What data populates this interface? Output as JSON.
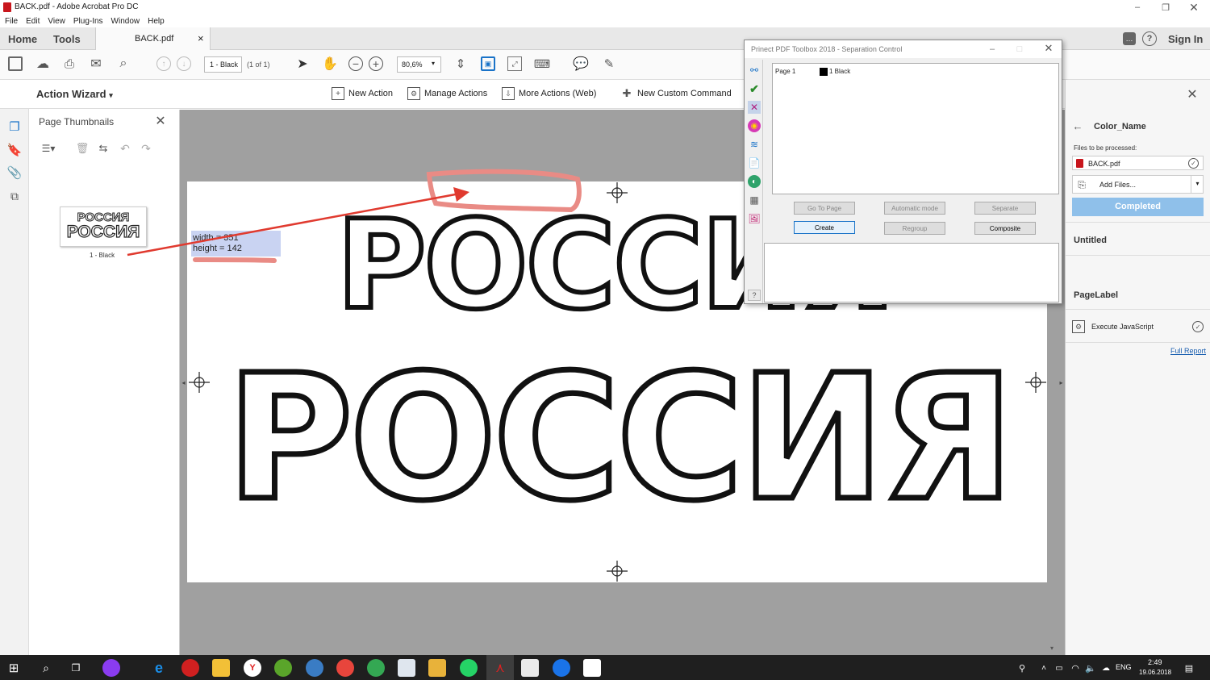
{
  "window": {
    "title": "BACK.pdf - Adobe Acrobat Pro DC"
  },
  "menu": [
    "File",
    "Edit",
    "View",
    "Plug-Ins",
    "Window",
    "Help"
  ],
  "tabs": {
    "home": "Home",
    "tools": "Tools",
    "doc": "BACK.pdf",
    "close": "×",
    "signin": "Sign In"
  },
  "toolbar": {
    "page_value": "1 - Black",
    "page_of": "(1 of 1)",
    "zoom": "80,6%"
  },
  "actionbar": {
    "title": "Action Wizard",
    "new_action": "New Action",
    "manage_actions": "Manage Actions",
    "more_actions": "More Actions (Web)",
    "new_custom": "New Custom Command"
  },
  "thumbs": {
    "title": "Page Thumbnails",
    "label": "1 - Black",
    "thumb_line": "РОССИЯ"
  },
  "annotation": {
    "width": "width = 351",
    "height": "height = 142"
  },
  "page_text": {
    "line1": "РОССИЯ",
    "line2": "РОССИЯ"
  },
  "dialog": {
    "title": "Prinect PDF Toolbox 2018 - Separation Control",
    "page": "Page 1",
    "sep": "1 Black",
    "go_to_page": "Go To Page",
    "automatic": "Automatic mode",
    "separate": "Separate",
    "create": "Create",
    "regroup": "Regroup",
    "composite": "Composite",
    "help": "?"
  },
  "right": {
    "back_title": "Color_Name",
    "files_label": "Files to be processed:",
    "file": "BACK.pdf",
    "add_files": "Add Files...",
    "completed": "Completed",
    "untitled": "Untitled",
    "pagelabel": "PageLabel",
    "execute_js": "Execute JavaScript",
    "full_report": "Full Report"
  },
  "taskbar": {
    "lang": "ENG",
    "time": "2:49",
    "date": "19.06.2018"
  },
  "colors": {
    "accent_blue": "#1a73c8",
    "annotation_red": "#e03a2f",
    "completed_bg": "#8fc0ea"
  }
}
